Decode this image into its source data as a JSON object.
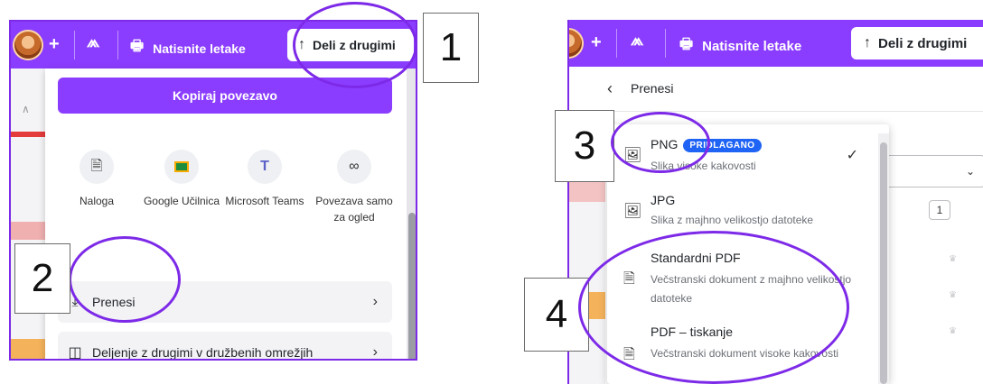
{
  "left_panel": {
    "toolbar": {
      "plus_label": "+",
      "print_label": "Natisnite letake",
      "share_label": "Deli z drugimi"
    },
    "copy_link_label": "Kopiraj povezavo",
    "share_options": [
      {
        "label": "Naloga",
        "icon": "document-icon"
      },
      {
        "label": "Google Učilnica",
        "icon": "google-classroom-icon"
      },
      {
        "label": "Microsoft Teams",
        "icon": "microsoft-teams-icon"
      },
      {
        "label": "Povezava samo za ogled",
        "icon": "link-icon"
      }
    ],
    "list_items": [
      {
        "label": "Prenesi",
        "icon": "download-icon"
      },
      {
        "label": "Deljenje z drugimi v družbenih omrežjih",
        "icon": "social-share-icon"
      }
    ]
  },
  "right_panel": {
    "toolbar": {
      "plus_label": "+",
      "print_label": "Natisnite letake",
      "share_label": "Deli z drugimi"
    },
    "header_title": "Prenesi",
    "side_value": "1",
    "formats": [
      {
        "name": "PNG",
        "badge": "PRIPOROČENO",
        "badge_visible": "PRIDLAGANO",
        "desc": "Slika visoke kakovosti",
        "selected": true
      },
      {
        "name": "JPG",
        "desc": "Slika z majhno velikostjo datoteke"
      },
      {
        "name": "Standardni PDF",
        "desc": "Večstranski dokument z majhno velikostjo datoteke"
      },
      {
        "name": "PDF – tiskanje",
        "desc": "Večstranski dokument visoke kakovosti"
      }
    ]
  },
  "callouts": [
    "1",
    "2",
    "3",
    "4"
  ],
  "colors": {
    "brand_purple": "#8b3dff",
    "annotation_purple": "#7d2ae8",
    "badge_blue": "#1f64f4"
  }
}
